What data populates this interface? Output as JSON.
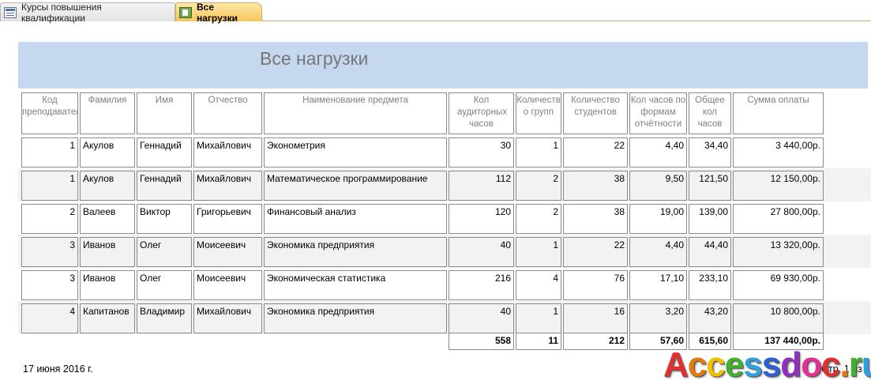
{
  "tabs": [
    {
      "label": "Курсы повышения квалификации",
      "icon": "form-icon"
    },
    {
      "label": "Все нагрузки",
      "icon": "report-icon",
      "active": true
    }
  ],
  "report": {
    "title": "Все нагрузки",
    "columns": {
      "code": "Код преподавателя",
      "surname": "Фамилия",
      "name": "Имя",
      "patronymic": "Отчество",
      "subject": "Наименование предмета",
      "aud_hours": "Кол аудиторных часов",
      "groups": "Количество групп",
      "students": "Количество студентов",
      "form_hours": "Кол часов по формам отчётности",
      "total_hours": "Общее кол часов",
      "payment": "Сумма оплаты"
    },
    "rows": [
      {
        "code": "1",
        "surname": "Акулов",
        "name": "Геннадий",
        "patronymic": "Михайлович",
        "subject": "Эконометрия",
        "aud_hours": "30",
        "groups": "1",
        "students": "22",
        "form_hours": "4,40",
        "total_hours": "34,40",
        "payment": "3 440,00р."
      },
      {
        "code": "1",
        "surname": "Акулов",
        "name": "Геннадий",
        "patronymic": "Михайлович",
        "subject": "Математическое программирование",
        "aud_hours": "112",
        "groups": "2",
        "students": "38",
        "form_hours": "9,50",
        "total_hours": "121,50",
        "payment": "12 150,00р."
      },
      {
        "code": "2",
        "surname": "Валеев",
        "name": "Виктор",
        "patronymic": "Григорьевич",
        "subject": "Финансовый анализ",
        "aud_hours": "120",
        "groups": "2",
        "students": "38",
        "form_hours": "19,00",
        "total_hours": "139,00",
        "payment": "27 800,00р."
      },
      {
        "code": "3",
        "surname": "Иванов",
        "name": "Олег",
        "patronymic": "Моисеевич",
        "subject": "Экономика предприятия",
        "aud_hours": "40",
        "groups": "1",
        "students": "22",
        "form_hours": "4,40",
        "total_hours": "44,40",
        "payment": "13 320,00р."
      },
      {
        "code": "3",
        "surname": "Иванов",
        "name": "Олег",
        "patronymic": "Моисеевич",
        "subject": "Экономическая статистика",
        "aud_hours": "216",
        "groups": "4",
        "students": "76",
        "form_hours": "17,10",
        "total_hours": "233,10",
        "payment": "69 930,00р."
      },
      {
        "code": "4",
        "surname": "Капитанов",
        "name": "Владимир",
        "patronymic": "Михайлович",
        "subject": "Экономика предприятия",
        "aud_hours": "40",
        "groups": "1",
        "students": "16",
        "form_hours": "3,20",
        "total_hours": "43,20",
        "payment": "10 800,00р."
      }
    ],
    "totals": {
      "aud_hours": "558",
      "groups": "11",
      "students": "212",
      "form_hours": "57,60",
      "total_hours": "615,60",
      "payment": "137 440,00р."
    },
    "footer": {
      "date": "17 июня 2016 г.",
      "page": "Стр. 1 из 1"
    },
    "watermark": "Accessdoc.ru",
    "colors": {
      "header_band": "#c5d8ef",
      "alt_row": "#f2f2f2",
      "active_tab": "#f8c55a"
    }
  }
}
